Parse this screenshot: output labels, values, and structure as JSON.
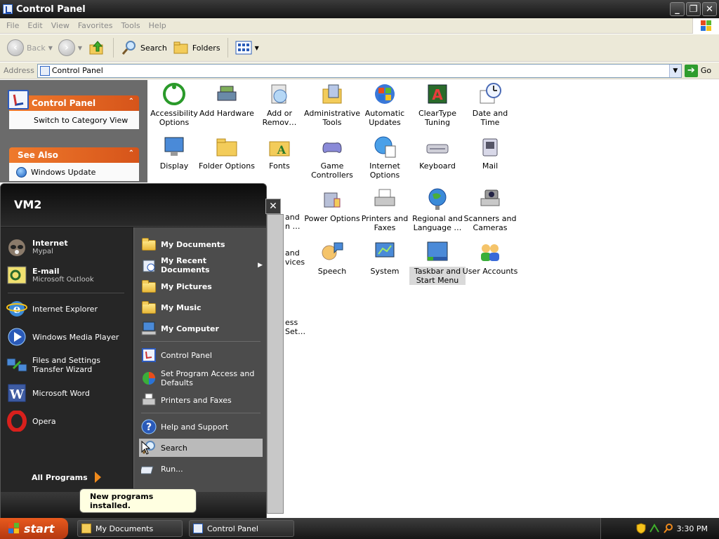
{
  "window": {
    "title": "Control Panel"
  },
  "menubar": [
    "File",
    "Edit",
    "View",
    "Favorites",
    "Tools",
    "Help"
  ],
  "toolbar": {
    "back": "Back",
    "search": "Search",
    "folders": "Folders"
  },
  "address": {
    "label": "Address",
    "value": "Control Panel",
    "go": "Go"
  },
  "taskpane": {
    "cp_title": "Control Panel",
    "switch_view": "Switch to Category View",
    "see_also": "See Also",
    "windows_update": "Windows Update"
  },
  "cp_items": [
    {
      "label": "Accessibility Options"
    },
    {
      "label": "Add Hardware"
    },
    {
      "label": "Add or Remov…"
    },
    {
      "label": "Administrative Tools"
    },
    {
      "label": "Automatic Updates"
    },
    {
      "label": "ClearType Tuning"
    },
    {
      "label": "Date and Time"
    },
    {
      "label": "Display"
    },
    {
      "label": "Folder Options"
    },
    {
      "label": "Fonts"
    },
    {
      "label": "Game Controllers"
    },
    {
      "label": "Internet Options"
    },
    {
      "label": "Keyboard"
    },
    {
      "label": "Mail"
    },
    {
      "label": "Power Options"
    },
    {
      "label": "Printers and Faxes"
    },
    {
      "label": "Regional and Language …"
    },
    {
      "label": "Scanners and Cameras"
    },
    {
      "label": "Speech"
    },
    {
      "label": "System"
    },
    {
      "label": "Taskbar and Start Menu"
    },
    {
      "label": "User Accounts"
    }
  ],
  "partial": {
    "r3a": "and",
    "r3b": "n …",
    "r4a": "and",
    "r4b": "vices",
    "r5a": "ess",
    "r5b": "Set…"
  },
  "startmenu": {
    "user": "VM2",
    "pinned": [
      {
        "title": "Internet",
        "sub": "Mypal"
      },
      {
        "title": "E-mail",
        "sub": "Microsoft Outlook"
      }
    ],
    "recent": [
      "Internet Explorer",
      "Windows Media Player",
      "Files and Settings Transfer Wizard",
      "Microsoft Word",
      "Opera"
    ],
    "all_programs": "All Programs",
    "right": {
      "my_documents": "My Documents",
      "my_recent": "My Recent Documents",
      "my_pictures": "My Pictures",
      "my_music": "My Music",
      "my_computer": "My Computer",
      "control_panel": "Control Panel",
      "set_program": "Set Program Access and Defaults",
      "printers": "Printers and Faxes",
      "help": "Help and Support",
      "search": "Search",
      "run": "Run..."
    }
  },
  "balloon": "New programs installed.",
  "taskbar": {
    "start": "start",
    "tasks": [
      "My Documents",
      "Control Panel"
    ],
    "clock": "3:30 PM"
  }
}
